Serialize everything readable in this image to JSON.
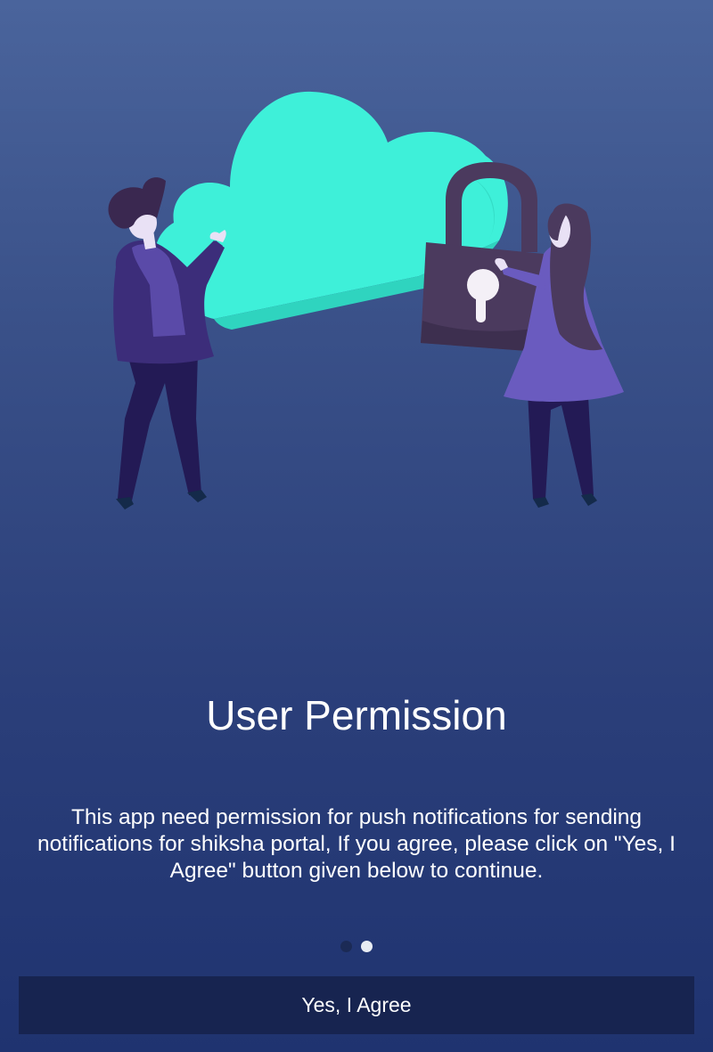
{
  "screen": {
    "title": "User Permission",
    "description": "This app need permission for push notifications for sending notifications for shiksha portal, If you agree, please click on \"Yes, I Agree\" button given below to continue.",
    "agree_button_label": "Yes, I Agree"
  },
  "pager": {
    "total_pages": 2,
    "current_page": 2
  },
  "illustration": {
    "icons": [
      "cloud-icon",
      "padlock-icon",
      "person-man",
      "person-woman"
    ]
  },
  "colors": {
    "cloud": "#3ef0d9",
    "padlock": "#4b3a5e",
    "button_bg": "#172450",
    "dot_active": "#e8ecf3",
    "dot_inactive": "#1b2a55"
  }
}
